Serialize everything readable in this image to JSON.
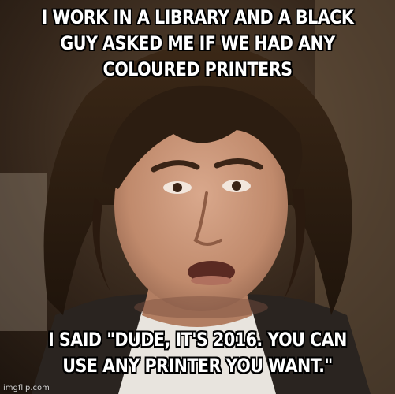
{
  "meme": {
    "top_text": "I WORK IN A LIBRARY AND A BLACK GUY ASKED ME IF WE HAD ANY COLOURED PRINTERS",
    "bottom_text": "I SAID \"DUDE, IT'S 2016. YOU CAN USE ANY PRINTER YOU WANT.\"",
    "watermark": "imgflip.com"
  },
  "colors": {
    "caption_fill": "#ffffff",
    "caption_outline": "#000000",
    "hair": "#2a1c12",
    "skin": "#c89478",
    "background": "#3a2a1e"
  }
}
